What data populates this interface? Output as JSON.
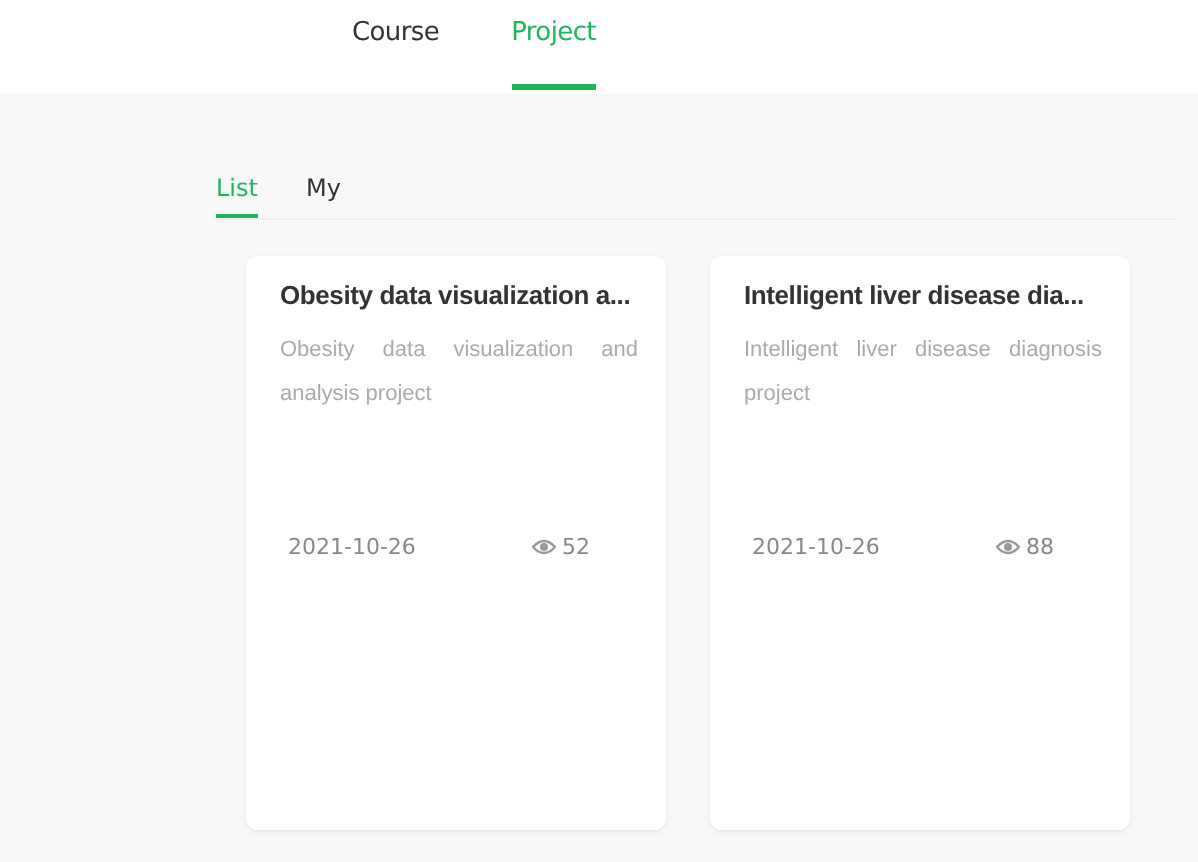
{
  "top_tabs": [
    {
      "label": "Course",
      "selected": false
    },
    {
      "label": "Project",
      "selected": true
    }
  ],
  "sub_tabs": [
    {
      "label": "List",
      "selected": true
    },
    {
      "label": "My",
      "selected": false
    }
  ],
  "projects": [
    {
      "title": "Obesity data visualization a...",
      "description": "Obesity data visualization and analysis project",
      "date": "2021-10-26",
      "views": "52"
    },
    {
      "title": "Intelligent liver disease dia...",
      "description": "Intelligent liver disease diagnosis project",
      "date": "2021-10-26",
      "views": "88"
    }
  ]
}
